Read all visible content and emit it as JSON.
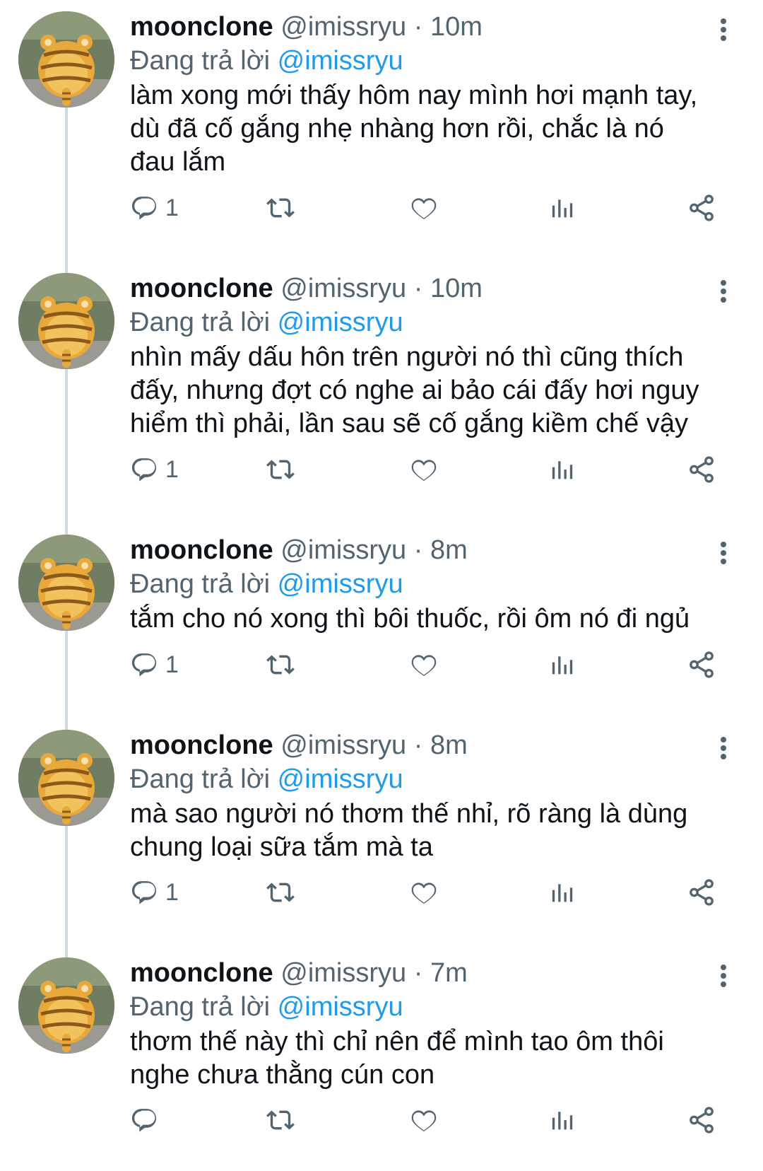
{
  "tweets": [
    {
      "name": "moonclone",
      "handle": "@imissryu",
      "separator": "·",
      "time": "10m",
      "reply_prefix": "Đang trả lời",
      "reply_to": "@imissryu",
      "lines": [
        "làm xong mới thấy hôm nay mình hơi mạnh tay,",
        "dù đã cố gắng nhẹ nhàng hơn rồi, chắc là nó",
        "đau lắm"
      ],
      "reply_count": "1"
    },
    {
      "name": "moonclone",
      "handle": "@imissryu",
      "separator": "·",
      "time": "10m",
      "reply_prefix": "Đang trả lời",
      "reply_to": "@imissryu",
      "lines": [
        "nhìn mấy dấu hôn trên người nó thì cũng thích",
        "đấy, nhưng đợt có nghe ai bảo cái đấy hơi nguy",
        "hiểm thì phải, lần sau sẽ cố gắng kiềm chế vậy"
      ],
      "reply_count": "1"
    },
    {
      "name": "moonclone",
      "handle": "@imissryu",
      "separator": "·",
      "time": "8m",
      "reply_prefix": "Đang trả lời",
      "reply_to": "@imissryu",
      "lines": [
        "tắm cho nó xong thì bôi thuốc, rồi ôm nó đi ngủ"
      ],
      "reply_count": "1"
    },
    {
      "name": "moonclone",
      "handle": "@imissryu",
      "separator": "·",
      "time": "8m",
      "reply_prefix": "Đang trả lời",
      "reply_to": "@imissryu",
      "lines": [
        "mà sao người nó thơm thế nhỉ, rõ ràng là dùng",
        "chung loại sữa tắm mà ta"
      ],
      "reply_count": "1"
    },
    {
      "name": "moonclone",
      "handle": "@imissryu",
      "separator": "·",
      "time": "7m",
      "reply_prefix": "Đang trả lời",
      "reply_to": "@imissryu",
      "lines": [
        "thơm thế này thì chỉ nên để mình tao ôm thôi",
        "nghe chưa thằng cún con"
      ],
      "reply_count": ""
    }
  ],
  "icons": {
    "more": "more-vertical-icon",
    "reply": "reply-icon",
    "retweet": "retweet-icon",
    "like": "heart-icon",
    "views": "analytics-icon",
    "share": "share-icon",
    "avatar": "tiger-avatar"
  },
  "colors": {
    "link": "#1d9bf0",
    "secondary_text": "#536471",
    "primary_text": "#0f1419",
    "thread_line": "#cfd9de",
    "icon": "#536471"
  }
}
